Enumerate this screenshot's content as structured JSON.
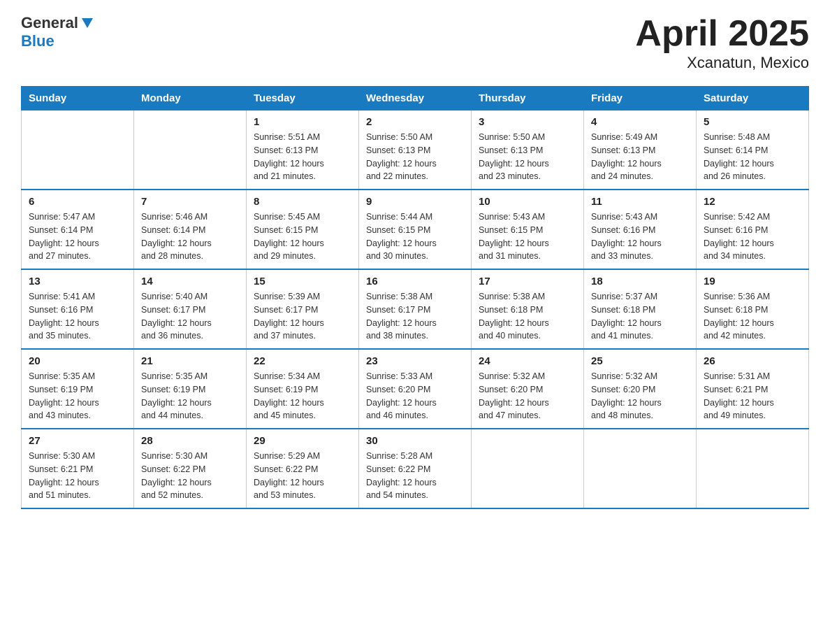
{
  "logo": {
    "line1": "General",
    "line2": "Blue"
  },
  "title": "April 2025",
  "subtitle": "Xcanatun, Mexico",
  "days_of_week": [
    "Sunday",
    "Monday",
    "Tuesday",
    "Wednesday",
    "Thursday",
    "Friday",
    "Saturday"
  ],
  "weeks": [
    [
      {
        "day": "",
        "info": ""
      },
      {
        "day": "",
        "info": ""
      },
      {
        "day": "1",
        "info": "Sunrise: 5:51 AM\nSunset: 6:13 PM\nDaylight: 12 hours\nand 21 minutes."
      },
      {
        "day": "2",
        "info": "Sunrise: 5:50 AM\nSunset: 6:13 PM\nDaylight: 12 hours\nand 22 minutes."
      },
      {
        "day": "3",
        "info": "Sunrise: 5:50 AM\nSunset: 6:13 PM\nDaylight: 12 hours\nand 23 minutes."
      },
      {
        "day": "4",
        "info": "Sunrise: 5:49 AM\nSunset: 6:13 PM\nDaylight: 12 hours\nand 24 minutes."
      },
      {
        "day": "5",
        "info": "Sunrise: 5:48 AM\nSunset: 6:14 PM\nDaylight: 12 hours\nand 26 minutes."
      }
    ],
    [
      {
        "day": "6",
        "info": "Sunrise: 5:47 AM\nSunset: 6:14 PM\nDaylight: 12 hours\nand 27 minutes."
      },
      {
        "day": "7",
        "info": "Sunrise: 5:46 AM\nSunset: 6:14 PM\nDaylight: 12 hours\nand 28 minutes."
      },
      {
        "day": "8",
        "info": "Sunrise: 5:45 AM\nSunset: 6:15 PM\nDaylight: 12 hours\nand 29 minutes."
      },
      {
        "day": "9",
        "info": "Sunrise: 5:44 AM\nSunset: 6:15 PM\nDaylight: 12 hours\nand 30 minutes."
      },
      {
        "day": "10",
        "info": "Sunrise: 5:43 AM\nSunset: 6:15 PM\nDaylight: 12 hours\nand 31 minutes."
      },
      {
        "day": "11",
        "info": "Sunrise: 5:43 AM\nSunset: 6:16 PM\nDaylight: 12 hours\nand 33 minutes."
      },
      {
        "day": "12",
        "info": "Sunrise: 5:42 AM\nSunset: 6:16 PM\nDaylight: 12 hours\nand 34 minutes."
      }
    ],
    [
      {
        "day": "13",
        "info": "Sunrise: 5:41 AM\nSunset: 6:16 PM\nDaylight: 12 hours\nand 35 minutes."
      },
      {
        "day": "14",
        "info": "Sunrise: 5:40 AM\nSunset: 6:17 PM\nDaylight: 12 hours\nand 36 minutes."
      },
      {
        "day": "15",
        "info": "Sunrise: 5:39 AM\nSunset: 6:17 PM\nDaylight: 12 hours\nand 37 minutes."
      },
      {
        "day": "16",
        "info": "Sunrise: 5:38 AM\nSunset: 6:17 PM\nDaylight: 12 hours\nand 38 minutes."
      },
      {
        "day": "17",
        "info": "Sunrise: 5:38 AM\nSunset: 6:18 PM\nDaylight: 12 hours\nand 40 minutes."
      },
      {
        "day": "18",
        "info": "Sunrise: 5:37 AM\nSunset: 6:18 PM\nDaylight: 12 hours\nand 41 minutes."
      },
      {
        "day": "19",
        "info": "Sunrise: 5:36 AM\nSunset: 6:18 PM\nDaylight: 12 hours\nand 42 minutes."
      }
    ],
    [
      {
        "day": "20",
        "info": "Sunrise: 5:35 AM\nSunset: 6:19 PM\nDaylight: 12 hours\nand 43 minutes."
      },
      {
        "day": "21",
        "info": "Sunrise: 5:35 AM\nSunset: 6:19 PM\nDaylight: 12 hours\nand 44 minutes."
      },
      {
        "day": "22",
        "info": "Sunrise: 5:34 AM\nSunset: 6:19 PM\nDaylight: 12 hours\nand 45 minutes."
      },
      {
        "day": "23",
        "info": "Sunrise: 5:33 AM\nSunset: 6:20 PM\nDaylight: 12 hours\nand 46 minutes."
      },
      {
        "day": "24",
        "info": "Sunrise: 5:32 AM\nSunset: 6:20 PM\nDaylight: 12 hours\nand 47 minutes."
      },
      {
        "day": "25",
        "info": "Sunrise: 5:32 AM\nSunset: 6:20 PM\nDaylight: 12 hours\nand 48 minutes."
      },
      {
        "day": "26",
        "info": "Sunrise: 5:31 AM\nSunset: 6:21 PM\nDaylight: 12 hours\nand 49 minutes."
      }
    ],
    [
      {
        "day": "27",
        "info": "Sunrise: 5:30 AM\nSunset: 6:21 PM\nDaylight: 12 hours\nand 51 minutes."
      },
      {
        "day": "28",
        "info": "Sunrise: 5:30 AM\nSunset: 6:22 PM\nDaylight: 12 hours\nand 52 minutes."
      },
      {
        "day": "29",
        "info": "Sunrise: 5:29 AM\nSunset: 6:22 PM\nDaylight: 12 hours\nand 53 minutes."
      },
      {
        "day": "30",
        "info": "Sunrise: 5:28 AM\nSunset: 6:22 PM\nDaylight: 12 hours\nand 54 minutes."
      },
      {
        "day": "",
        "info": ""
      },
      {
        "day": "",
        "info": ""
      },
      {
        "day": "",
        "info": ""
      }
    ]
  ]
}
